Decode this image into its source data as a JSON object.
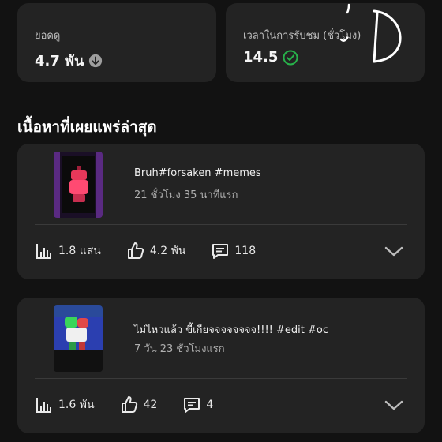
{
  "stats": {
    "views": {
      "label": "ยอดดู",
      "value": "4.7 พัน"
    },
    "watch_time": {
      "label": "เวลาในการรับชม (ชั่วโมง)",
      "value": "14.5"
    }
  },
  "section": {
    "title": "เนื้อหาที่เผยแพร่ล่าสุด"
  },
  "videos": [
    {
      "title": "Bruh#forsaken #memes",
      "age": "21 ชั่วโมง 35 นาทีแรก",
      "views": "1.8 แสน",
      "likes": "4.2 พัน",
      "comments": "118"
    },
    {
      "title": "ไม่ไหวแล้ว ขี้เกียจจจจจจจจ!!!! #edit #oc",
      "age": "7 วัน 23 ชั่วโมงแรก",
      "views": "1.6 พัน",
      "likes": "42",
      "comments": "4"
    }
  ],
  "colors": {
    "background": "#121212",
    "card": "#232323",
    "success": "#27b14a"
  }
}
